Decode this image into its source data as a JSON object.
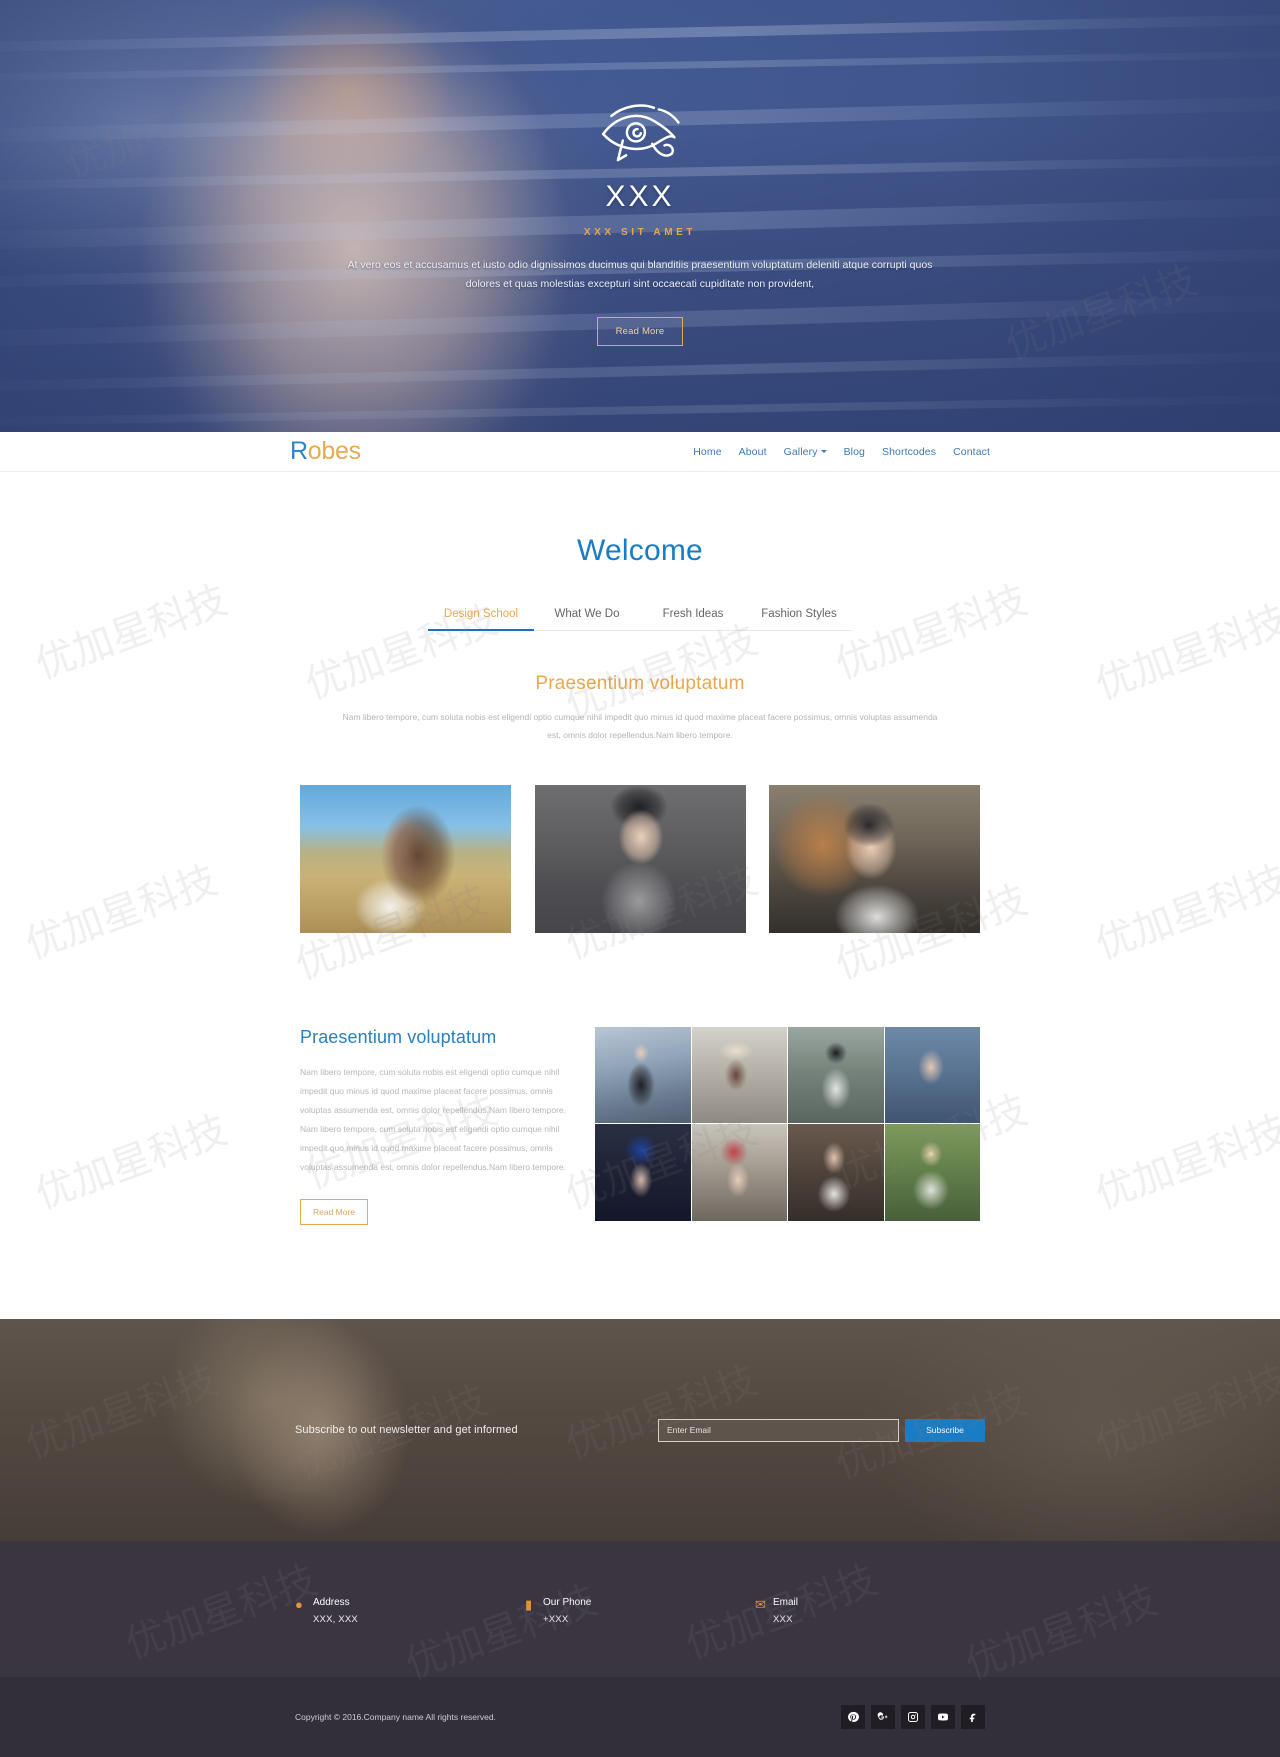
{
  "hero": {
    "logo_icon": "eye-of-horus-icon",
    "brand": "XXX",
    "tagline": "XXX SIT AMET",
    "description": "At vero eos et accusamus et iusto odio dignissimos ducimus qui blanditiis praesentium voluptatum deleniti atque corrupti quos dolores et quas molestias excepturi sint occaecati cupiditate non provident,",
    "button": "Read More"
  },
  "navbar": {
    "brand_first": "R",
    "brand_rest": "obes",
    "links": [
      {
        "label": "Home",
        "dropdown": false
      },
      {
        "label": "About",
        "dropdown": false
      },
      {
        "label": "Gallery",
        "dropdown": true
      },
      {
        "label": "Blog",
        "dropdown": false
      },
      {
        "label": "Shortcodes",
        "dropdown": false
      },
      {
        "label": "Contact",
        "dropdown": false
      }
    ]
  },
  "welcome": {
    "title": "Welcome",
    "tabs": [
      {
        "label": "Design School",
        "active": true
      },
      {
        "label": "What We Do",
        "active": false
      },
      {
        "label": "Fresh Ideas",
        "active": false
      },
      {
        "label": "Fashion Styles",
        "active": false
      }
    ],
    "subtitle": "Praesentium voluptatum",
    "description": "Nam libero tempore, cum soluta nobis est eligendi optio cumque nihil impedit quo minus id quod maxime placeat facere possimus, omnis voluptas assumenda est, omnis dolor repellendus.Nam libero tempore."
  },
  "feature": {
    "heading": "Praesentium voluptatum",
    "body": "Nam libero tempore, cum soluta nobis est eligendi optio cumque nihil impedit quo minus id quod maxime placeat facere possimus, omnis voluptas assumenda est, omnis dolor repellendus.Nam libero tempore. Nam libero tempore, cum soluta nobis est eligendi optio cumque nihil impedit quo minus id quod maxime placeat facere possimus, omnis voluptas assumenda est, omnis dolor repellendus.Nam libero tempore.",
    "button": "Read More"
  },
  "newsletter": {
    "text": "Subscribe to out newsletter and get informed",
    "placeholder": "Enter Email",
    "button": "Subscribe"
  },
  "footer": {
    "contacts": [
      {
        "icon": "location-pin-icon",
        "label": "Address",
        "value": "XXX, XXX"
      },
      {
        "icon": "mobile-phone-icon",
        "label": "Our Phone",
        "value": "+XXX"
      },
      {
        "icon": "envelope-icon",
        "label": "Email",
        "value": "XXX"
      }
    ],
    "copyright": "Copyright © 2016.Company name All rights reserved.",
    "socials": [
      {
        "name": "pinterest-icon",
        "glyph": "P"
      },
      {
        "name": "google-plus-icon",
        "glyph": "g+"
      },
      {
        "name": "instagram-icon",
        "glyph": "IG"
      },
      {
        "name": "youtube-icon",
        "glyph": "YT"
      },
      {
        "name": "facebook-icon",
        "glyph": "f"
      }
    ]
  },
  "colors": {
    "accent_orange": "#e8a951",
    "accent_blue": "#1a7cc4",
    "footer_dark": "#3b3542",
    "footer_darker": "#332f3a"
  },
  "watermark": {
    "text": "优加星科技"
  }
}
